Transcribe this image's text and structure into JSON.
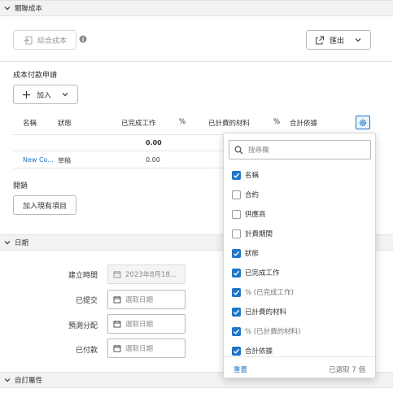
{
  "colors": {
    "accent": "#1d75c9",
    "header_bg": "#f2f2f2"
  },
  "sections": {
    "related_cost": "關聯成本",
    "dates": "日期",
    "custom_attrs": "自訂屬性"
  },
  "toolbar": {
    "combine_cost": "綜合成本",
    "export": "匯出"
  },
  "payment_requests": {
    "title": "成本付款申請",
    "add_label": "加入",
    "columns": [
      "名稱",
      "狀態",
      "已完成工作",
      "%",
      "已計費的材料",
      "%",
      "合計依據"
    ],
    "total_row": {
      "completed_work": "0.00"
    },
    "rows": [
      {
        "name": "New Co...",
        "status": "草稿",
        "completed_work": "0.00"
      }
    ]
  },
  "open_section": {
    "title": "開銷",
    "add_existing": "加入現有項目"
  },
  "dates": {
    "created_label": "建立時間",
    "created_value": "2023年8月18...",
    "submitted_label": "已提交",
    "forecast_label": "預測分配",
    "paid_label": "已付款",
    "placeholder": "選取日期"
  },
  "column_picker": {
    "search_placeholder": "搜尋欄",
    "options": [
      {
        "label": "名稱",
        "checked": true
      },
      {
        "label": "合約",
        "checked": false
      },
      {
        "label": "供應商",
        "checked": false
      },
      {
        "label": "計費期間",
        "checked": false
      },
      {
        "label": "狀態",
        "checked": true
      },
      {
        "label": "已完成工作",
        "checked": true
      },
      {
        "label": "% (已完成工作)",
        "checked": true
      },
      {
        "label": "已計費的材料",
        "checked": true
      },
      {
        "label": "% (已計費的材料)",
        "checked": true
      },
      {
        "label": "合計依據",
        "checked": true
      }
    ],
    "reset": "重置",
    "selected_count": "已選取 7 個"
  }
}
